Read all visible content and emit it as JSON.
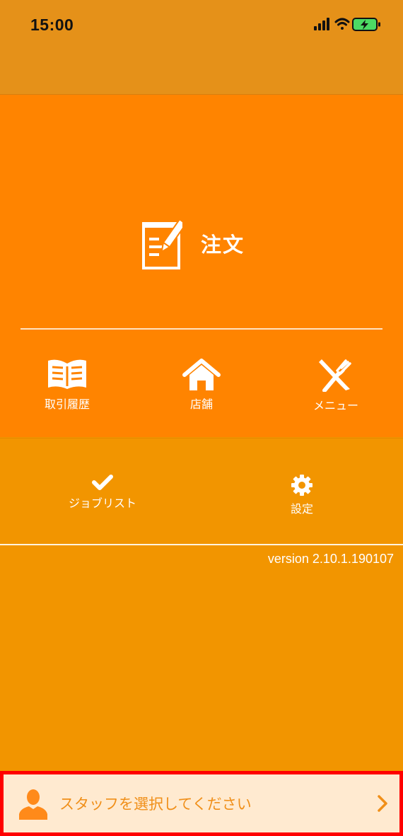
{
  "status_bar": {
    "time": "15:00",
    "icons": [
      "signal-icon",
      "wifi-icon",
      "battery-charging-icon"
    ]
  },
  "order": {
    "label": "注文",
    "icon": "order-edit-icon"
  },
  "nav": {
    "history": {
      "label": "取引履歴",
      "icon": "book-icon"
    },
    "store": {
      "label": "店舗",
      "icon": "home-icon"
    },
    "menu": {
      "label": "メニュー",
      "icon": "fork-knife-icon"
    }
  },
  "tools": {
    "joblist": {
      "label": "ジョブリスト",
      "icon": "checkmark-icon"
    },
    "settings": {
      "label": "設定",
      "icon": "gear-icon"
    }
  },
  "version": "version 2.10.1.190107",
  "staff": {
    "prompt": "スタッフを選択してください",
    "icon": "person-icon"
  },
  "colors": {
    "header_bg": "#e59119",
    "order_panel_bg": "#ff8400",
    "body_bg": "#f29500",
    "staff_bar_bg": "#ffead0",
    "staff_text": "#f08f19",
    "highlight_border": "#ff0000"
  }
}
